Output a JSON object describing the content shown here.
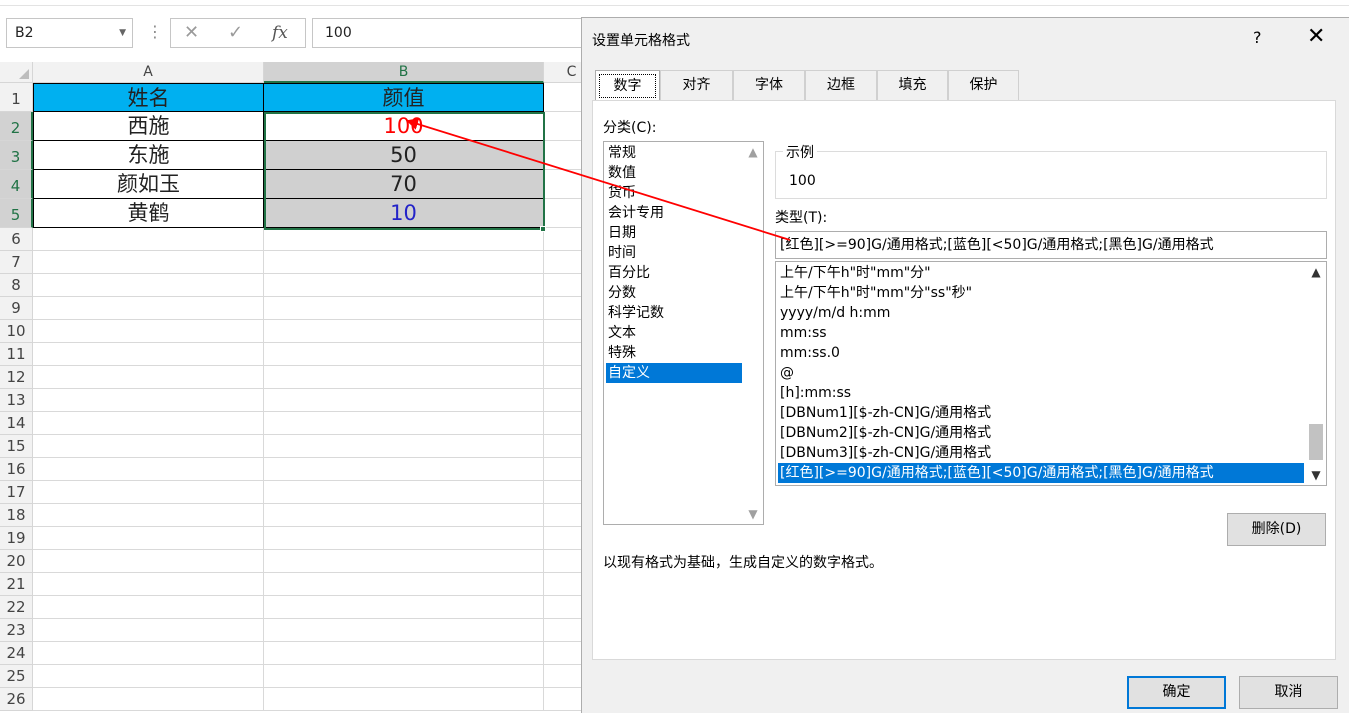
{
  "formula_bar": {
    "name_box": "B2",
    "cancel_icon": "✕",
    "enter_icon": "✓",
    "function_icon": "fx",
    "formula": "100"
  },
  "sheet": {
    "columns": [
      "A",
      "B",
      "C"
    ],
    "rows": [
      "1",
      "2",
      "3",
      "4",
      "5",
      "6",
      "7",
      "8",
      "9",
      "10",
      "11",
      "12",
      "13",
      "14",
      "15",
      "16",
      "17",
      "18",
      "19",
      "20",
      "21",
      "22",
      "23",
      "24",
      "25",
      "26"
    ],
    "table": {
      "headers": [
        "姓名",
        "颜值"
      ],
      "data": [
        {
          "name": "西施",
          "value": "100",
          "value_color": "#ff0000"
        },
        {
          "name": "东施",
          "value": "50",
          "value_color": "#222222"
        },
        {
          "name": "颜如玉",
          "value": "70",
          "value_color": "#222222"
        },
        {
          "name": "黄鹤",
          "value": "10",
          "value_color": "#2323c8"
        }
      ]
    },
    "header_fill": "#00b0f0",
    "selection_fill": "#d0d0d0",
    "selection_border": "#217346"
  },
  "dialog": {
    "title": "设置单元格格式",
    "help": "?",
    "close": "✕",
    "tabs": [
      "数字",
      "对齐",
      "字体",
      "边框",
      "填充",
      "保护"
    ],
    "category_label": "分类(C):",
    "categories": [
      "常规",
      "数值",
      "货币",
      "会计专用",
      "日期",
      "时间",
      "百分比",
      "分数",
      "科学记数",
      "文本",
      "特殊",
      "自定义"
    ],
    "selected_category": 11,
    "sample_label": "示例",
    "sample_value": "100",
    "type_label": "类型(T):",
    "type_value": "[红色][>=90]G/通用格式;[蓝色][<50]G/通用格式;[黑色]G/通用格式",
    "type_list": [
      "上午/下午h\"时\"mm\"分\"",
      "上午/下午h\"时\"mm\"分\"ss\"秒\"",
      "yyyy/m/d h:mm",
      "mm:ss",
      "mm:ss.0",
      "@",
      "[h]:mm:ss",
      "[DBNum1][$-zh-CN]G/通用格式",
      "[DBNum2][$-zh-CN]G/通用格式",
      "[DBNum3][$-zh-CN]G/通用格式",
      "[红色][>=90]G/通用格式;[蓝色][<50]G/通用格式;[黑色]G/通用格式"
    ],
    "selected_type": 10,
    "delete_button": "删除(D)",
    "description": "以现有格式为基础，生成自定义的数字格式。",
    "ok_button": "确定",
    "cancel_button": "取消",
    "accent": "#0078d7"
  },
  "annotation": {
    "arrow_color": "#ff0000",
    "arrow_icon": "red-arrow-icon"
  }
}
